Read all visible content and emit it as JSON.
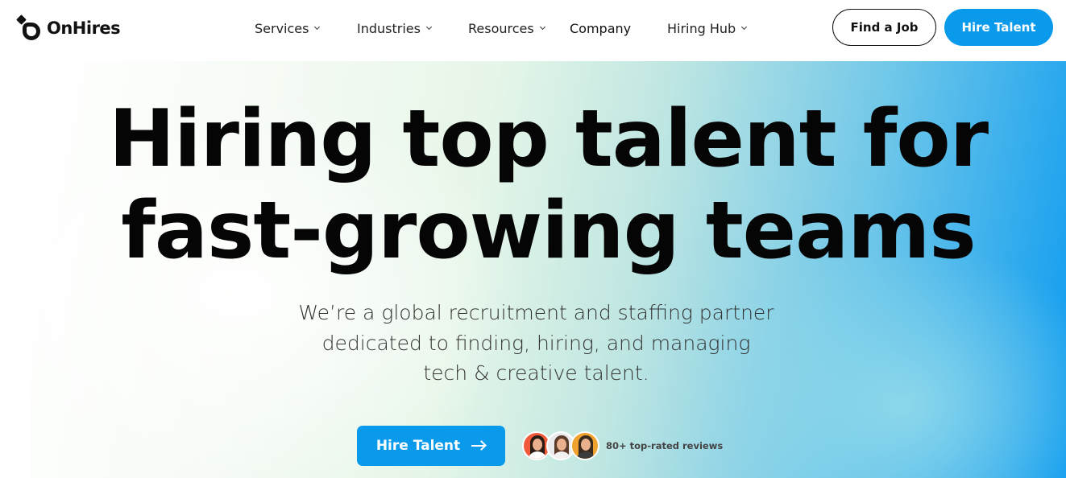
{
  "brand": {
    "name": "OnHires"
  },
  "nav": {
    "items": [
      {
        "label": "Services",
        "has_dropdown": true
      },
      {
        "label": "Industries",
        "has_dropdown": true
      },
      {
        "label": "Resources",
        "has_dropdown": true
      },
      {
        "label": "Company",
        "has_dropdown": false
      },
      {
        "label": "Hiring Hub",
        "has_dropdown": true
      }
    ],
    "find_job_label": "Find a Job",
    "hire_talent_label": "Hire Talent"
  },
  "hero": {
    "headline_lines": [
      "Hiring top talent for",
      "fast-growing teams"
    ],
    "subtitle_lines": [
      "We’re a global recruitment and staffing partner",
      "dedicated to finding, hiring, and managing",
      "tech & creative talent."
    ],
    "cta_label": "Hire Talent",
    "cta_icon": "arrow-right-icon",
    "reviews_text": "80+ top-rated reviews",
    "reviewer_avatars": [
      {
        "bg": "#f05a3a",
        "hair": "#2b1a12",
        "shirt": "#ffffff"
      },
      {
        "bg": "#e9e9ee",
        "hair": "#5a3a28",
        "shirt": "#f2f2f2"
      },
      {
        "bg": "#f0a22e",
        "hair": "#3a2a1e",
        "shirt": "#3b3b3b"
      }
    ]
  },
  "colors": {
    "accent": "#0a9aec",
    "text_dark": "#050505",
    "gradient_end": "#0d9bf0"
  }
}
